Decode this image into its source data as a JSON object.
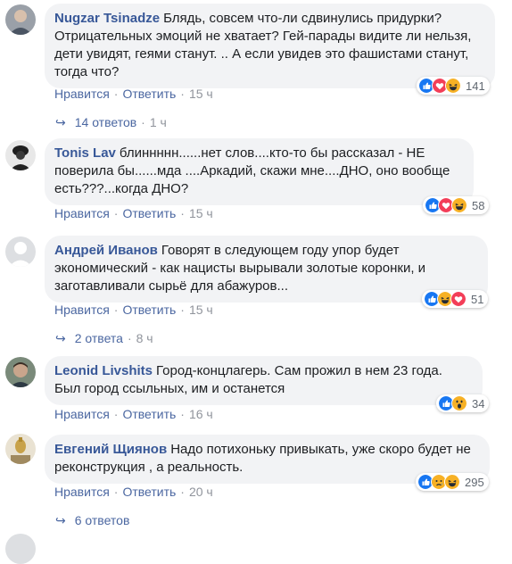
{
  "comments": [
    {
      "author": "Nugzar Tsinadze",
      "text": "Блядь, совсем что-ли сдвинулись придурки? Отрицательных эмоций не хватает? Гей-парады видите ли нельзя, дети увидят, геями станут. .. А если увидев это фашистами станут, тогда что?",
      "like": "Нравится",
      "reply": "Ответить",
      "time": "15 ч",
      "reactions": [
        "like-icon",
        "love-icon",
        "haha-icon"
      ],
      "count": "141",
      "replies": "14 ответов",
      "replies_time": "1 ч"
    },
    {
      "author": "Tonis Lav",
      "text": "блиннннн......нет слов....кто-то бы рассказал - НЕ поверила бы......мда ....Аркадий, скажи мне....ДНО, оно вообще есть???...когда ДНО?",
      "like": "Нравится",
      "reply": "Ответить",
      "time": "15 ч",
      "reactions": [
        "like-icon",
        "love-icon",
        "haha-icon"
      ],
      "count": "58"
    },
    {
      "author": "Андрей Иванов",
      "text": "Говорят в следующем году упор будет экономический - как нацисты вырывали золотые коронки, и заготавливали сырьё для абажуров...",
      "like": "Нравится",
      "reply": "Ответить",
      "time": "15 ч",
      "reactions": [
        "like-icon",
        "haha-icon",
        "love-icon"
      ],
      "count": "51",
      "replies": "2 ответа",
      "replies_time": "8 ч"
    },
    {
      "author": "Leonid Livshits",
      "text": "Город-концлагерь. Сам прожил в нем 23 года. Был город ссыльных, им и останется",
      "like": "Нравится",
      "reply": "Ответить",
      "time": "16 ч",
      "reactions": [
        "like-icon",
        "wow-icon"
      ],
      "count": "34"
    },
    {
      "author": "Евгений Щиянов",
      "text": "Надо потихоньку привыкать, уже скоро будет не реконструкция , а реальность.",
      "like": "Нравится",
      "reply": "Ответить",
      "time": "20 ч",
      "reactions": [
        "like-icon",
        "sad-icon",
        "haha-icon"
      ],
      "count": "295",
      "replies": "6 ответов"
    }
  ],
  "colors": {
    "name": "#385898",
    "link": "#4b67a1",
    "bubble": "#f2f3f5",
    "like": "#1877f2",
    "love": "#f33e58",
    "haha": "#f7b125"
  }
}
